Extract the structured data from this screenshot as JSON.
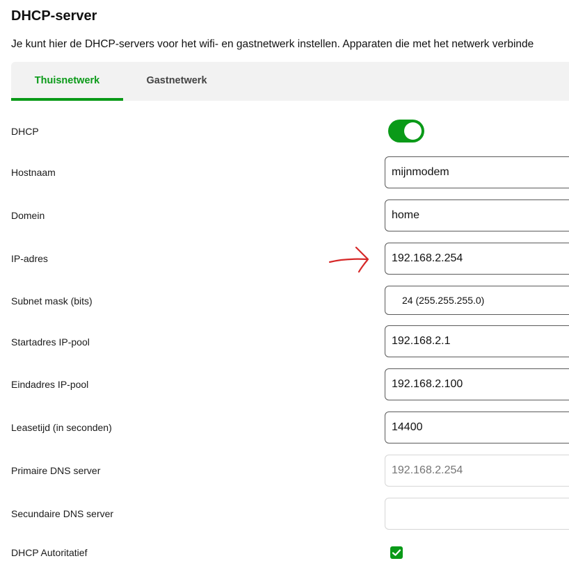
{
  "page": {
    "title": "DHCP-server",
    "description": "Je kunt hier de DHCP-servers voor het wifi- en gastnetwerk instellen. Apparaten die met het netwerk verbinde"
  },
  "tabs": [
    {
      "label": "Thuisnetwerk",
      "active": true
    },
    {
      "label": "Gastnetwerk",
      "active": false
    }
  ],
  "form": {
    "dhcp": {
      "label": "DHCP",
      "enabled": true
    },
    "hostname": {
      "label": "Hostnaam",
      "value": "mijnmodem"
    },
    "domain": {
      "label": "Domein",
      "value": "home"
    },
    "ip_address": {
      "label": "IP-adres",
      "value": "192.168.2.254"
    },
    "subnet_mask": {
      "label": "Subnet mask (bits)",
      "selected": "24 (255.255.255.0)"
    },
    "pool_start": {
      "label": "Startadres IP-pool",
      "value": "192.168.2.1"
    },
    "pool_end": {
      "label": "Eindadres IP-pool",
      "value": "192.168.2.100"
    },
    "lease_time": {
      "label": "Leasetijd (in seconden)",
      "value": "14400"
    },
    "primary_dns": {
      "label": "Primaire DNS server",
      "placeholder": "192.168.2.254"
    },
    "secondary_dns": {
      "label": "Secundaire DNS server",
      "value": ""
    },
    "dhcp_authoritative": {
      "label": "DHCP Autoritatief",
      "checked": true
    }
  },
  "colors": {
    "accent": "#0a9a18",
    "tabbar_bg": "#f2f2f2",
    "annotation_arrow": "#d62828"
  },
  "icons": {
    "toggle": "toggle-switch-icon",
    "checkbox": "checkmark-icon",
    "annotation": "hand-drawn-arrow-icon"
  }
}
